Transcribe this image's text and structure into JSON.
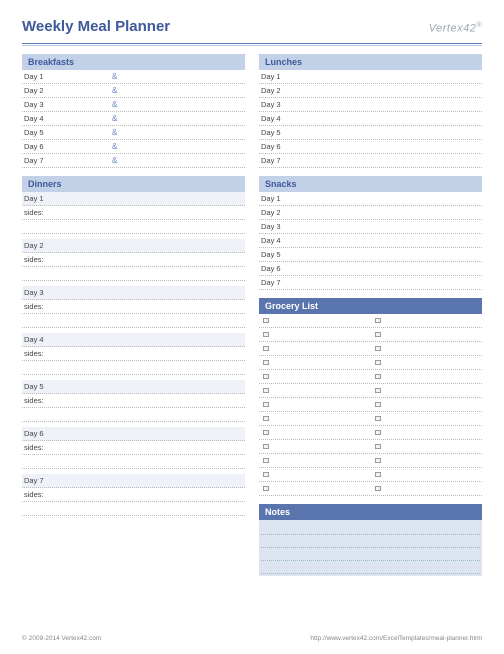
{
  "title": "Weekly Meal Planner",
  "logo": "Vertex42",
  "sections": {
    "breakfasts": "Breakfasts",
    "lunches": "Lunches",
    "dinners": "Dinners",
    "snacks": "Snacks",
    "grocery": "Grocery List",
    "notes": "Notes"
  },
  "days": [
    "Day 1",
    "Day 2",
    "Day 3",
    "Day 4",
    "Day 5",
    "Day 6",
    "Day 7"
  ],
  "sides_label": "sides:",
  "amp": "&",
  "footer": {
    "copyright": "© 2009-2014 Vertex42.com",
    "url": "http://www.vertex42.com/ExcelTemplates/meal-planner.html"
  }
}
